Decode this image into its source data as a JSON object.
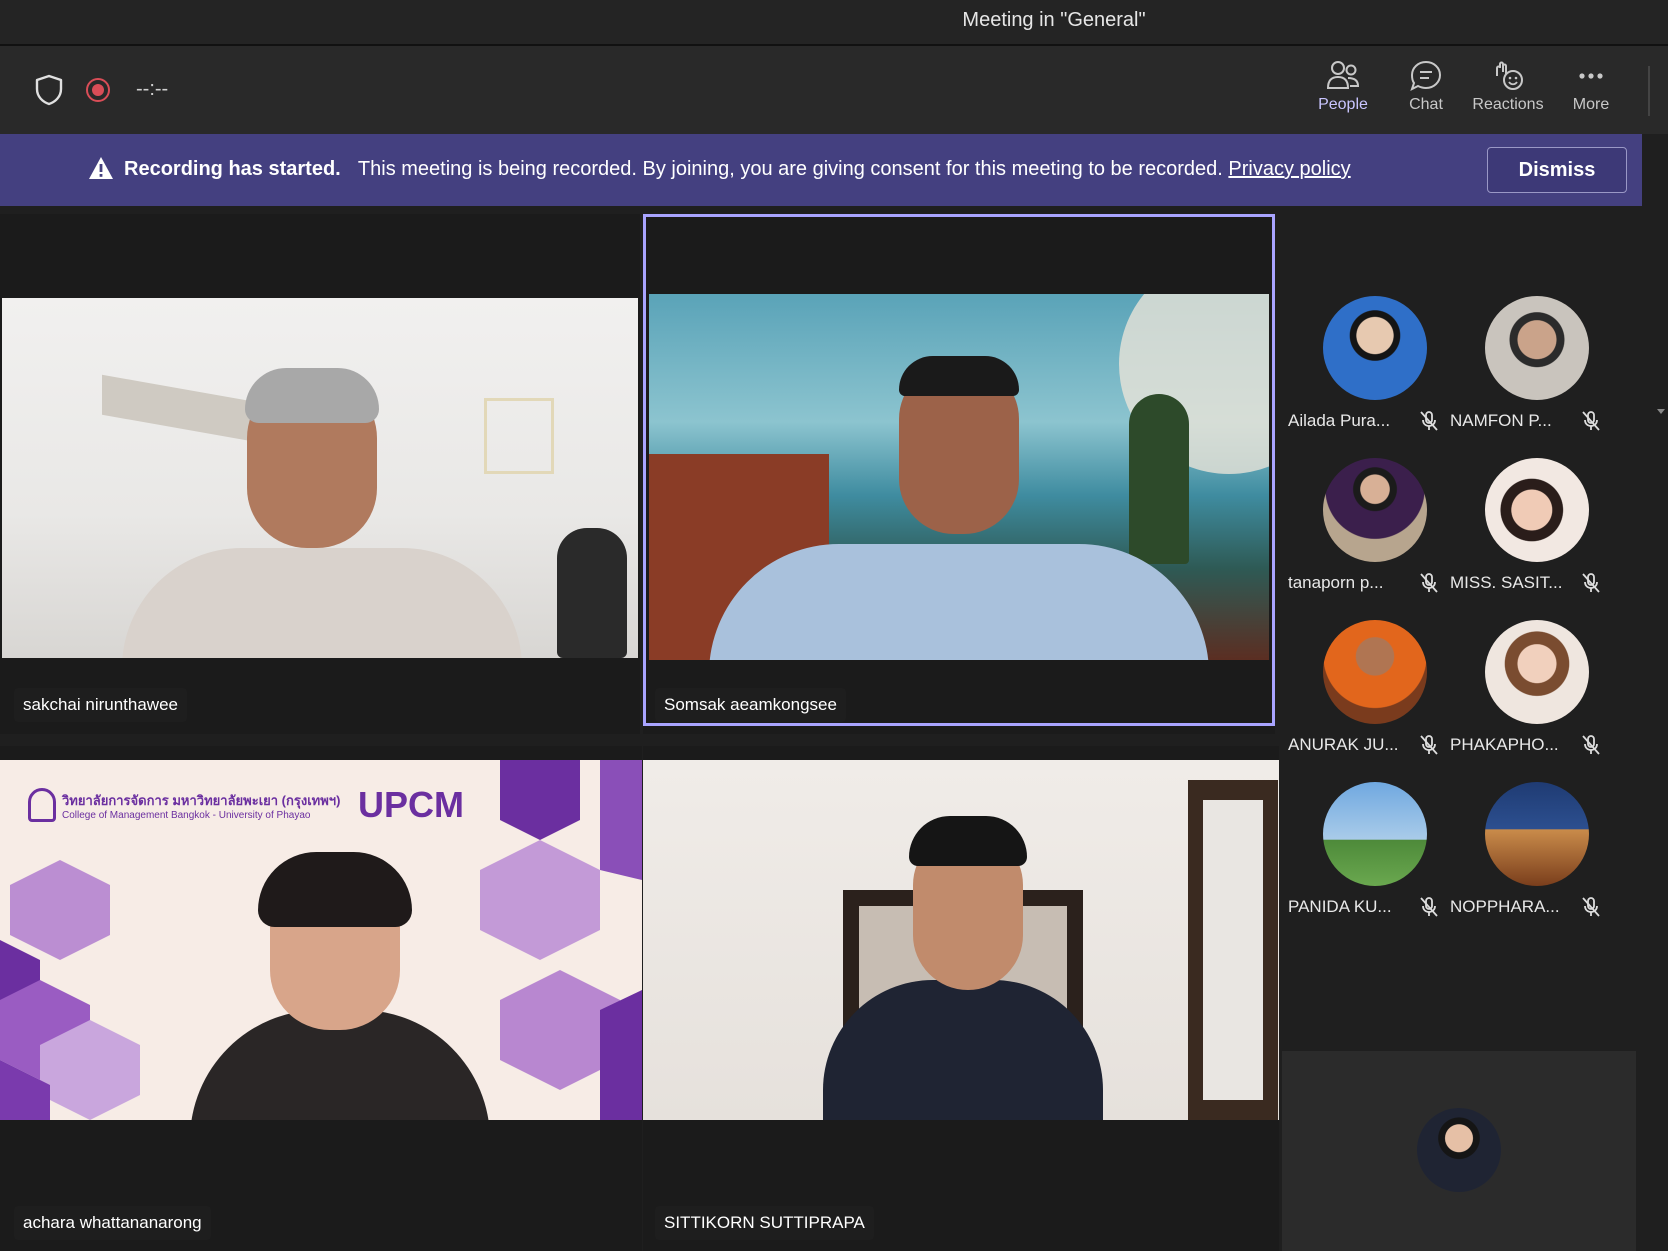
{
  "window": {
    "title": "Meeting in \"General\""
  },
  "toolbar": {
    "timer": "--:--",
    "tools": [
      {
        "label": "People",
        "icon": "people-icon",
        "active": true
      },
      {
        "label": "Chat",
        "icon": "chat-icon",
        "active": false
      },
      {
        "label": "Reactions",
        "icon": "reactions-icon",
        "active": false
      },
      {
        "label": "More",
        "icon": "more-icon",
        "active": false
      }
    ]
  },
  "banner": {
    "heading": "Recording has started.",
    "message": "This meeting is being recorded. By joining, you are giving consent for this meeting to be recorded.",
    "link": "Privacy policy",
    "dismiss": "Dismiss"
  },
  "video_tiles": [
    {
      "name": "sakchai nirunthawee"
    },
    {
      "name": "Somsak aeamkongsee"
    },
    {
      "name": "achara whattananarong"
    },
    {
      "name": "SITTIKORN SUTTIPRAPA"
    }
  ],
  "slide": {
    "thai_title": "วิทยาลัยการจัดการ มหาวิทยาลัยพะเยา (กรุงเทพฯ)",
    "english_title": "College of Management Bangkok - University of Phayao",
    "brand": "UPCM"
  },
  "participants": [
    {
      "name": "Ailada Pura...",
      "muted": true
    },
    {
      "name": "NAMFON P...",
      "muted": true
    },
    {
      "name": "tanaporn p...",
      "muted": true
    },
    {
      "name": "MISS. SASIT...",
      "muted": true
    },
    {
      "name": "ANURAK JU...",
      "muted": true
    },
    {
      "name": "PHAKAPHO...",
      "muted": true
    },
    {
      "name": "PANIDA KU...",
      "muted": true
    },
    {
      "name": "NOPPHARA...",
      "muted": true
    }
  ],
  "colors": {
    "accent": "#8f8af0",
    "banner": "#444080",
    "recording": "#d94d57",
    "brand_purple": "#6b2fa0"
  }
}
